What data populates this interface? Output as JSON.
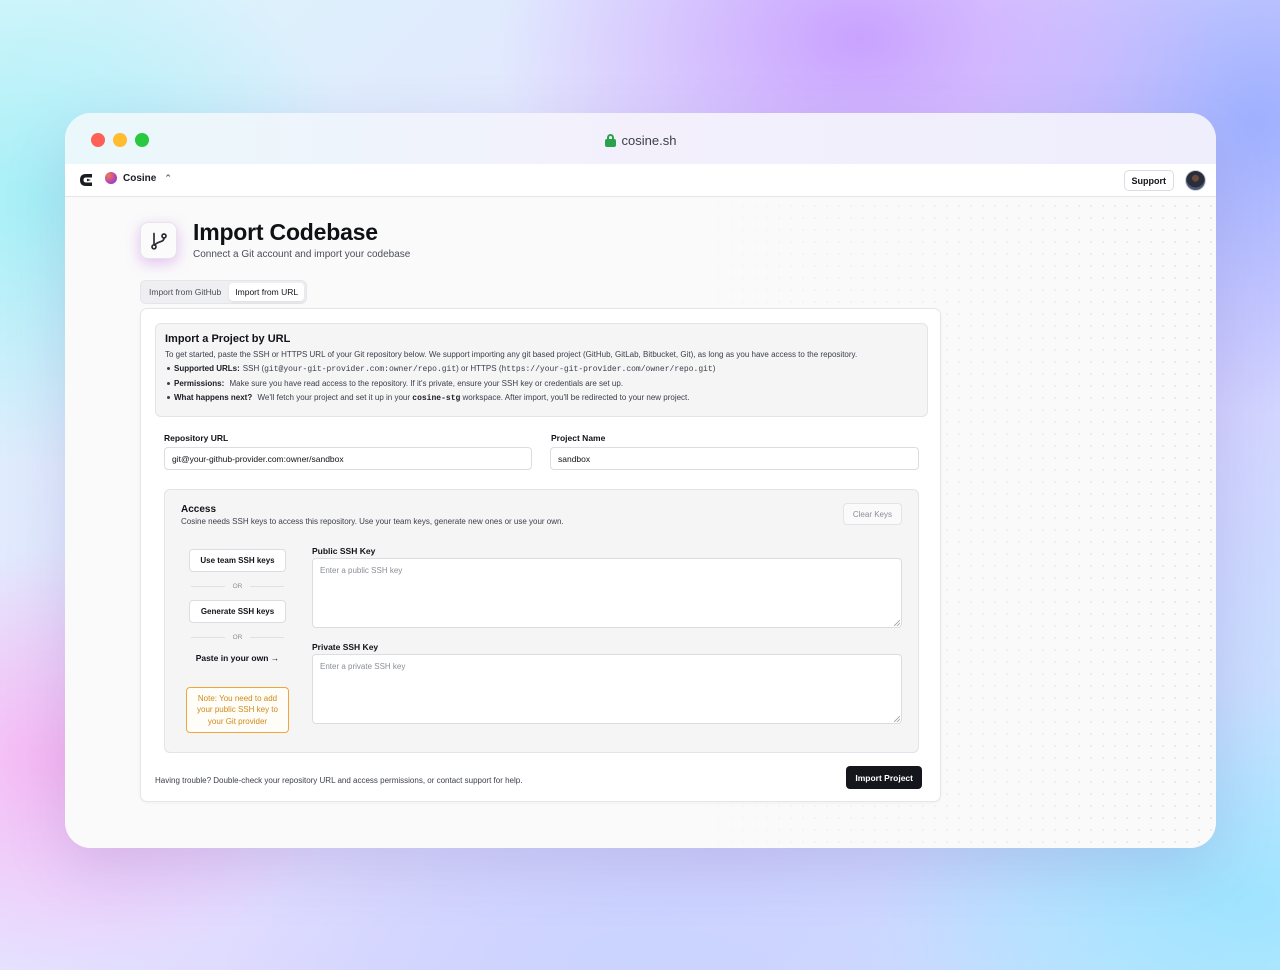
{
  "browser": {
    "url": "cosine.sh"
  },
  "nav": {
    "org_name": "Cosine",
    "support_label": "Support"
  },
  "header": {
    "title": "Import Codebase",
    "subtitle": "Connect a Git account and import your codebase"
  },
  "tabs": [
    {
      "label": "Import from GitHub",
      "active": false
    },
    {
      "label": "Import from URL",
      "active": true
    }
  ],
  "info": {
    "title": "Import a Project by URL",
    "description": "To get started, paste the SSH or HTTPS URL of your Git repository below. We support importing any git based project (GitHub, GitLab, Bitbucket, Git), as long as you have access to the repository.",
    "items": [
      {
        "label": "Supported URLs:",
        "pre1": "SSH (",
        "code1": "git@your-git-provider.com:owner/repo.git",
        "mid": ") or HTTPS (",
        "code2": "https://your-git-provider.com/owner/repo.git",
        "post": ")"
      },
      {
        "label": "Permissions:",
        "text": "Make sure you have read access to the repository. If it's private, ensure your SSH key or credentials are set up."
      },
      {
        "label": "What happens next?",
        "pre": "We'll fetch your project and set it up in your",
        "code": "cosine-stg",
        "post": "workspace. After import, you'll be redirected to your new project."
      }
    ]
  },
  "form": {
    "repo_url_label": "Repository URL",
    "repo_url_value": "git@your-github-provider.com:owner/sandbox",
    "project_name_label": "Project Name",
    "project_name_value": "sandbox"
  },
  "access": {
    "title": "Access",
    "description": "Cosine needs SSH keys to access this repository. Use your team keys, generate new ones or use your own.",
    "clear_label": "Clear Keys",
    "use_team_label": "Use team SSH keys",
    "or_label": "OR",
    "generate_label": "Generate SSH keys",
    "paste_label": "Paste in your own →",
    "note": "Note: You need to add your public SSH key to your Git provider",
    "public_key_label": "Public SSH Key",
    "public_key_placeholder": "Enter a public SSH key",
    "private_key_label": "Private SSH Key",
    "private_key_placeholder": "Enter a private SSH key"
  },
  "footer": {
    "help_text": "Having trouble? Double-check your repository URL and access permissions, or contact support for help.",
    "import_label": "Import Project"
  },
  "colors": {
    "primary_button": "#15161c",
    "note_accent": "#f0a63a",
    "lock_green": "#2aa24c"
  },
  "icons": [
    "lock-icon",
    "cosine-logo-icon",
    "chevron-updown-icon",
    "git-branch-icon",
    "arrow-right-icon",
    "resize-handle-icon"
  ]
}
